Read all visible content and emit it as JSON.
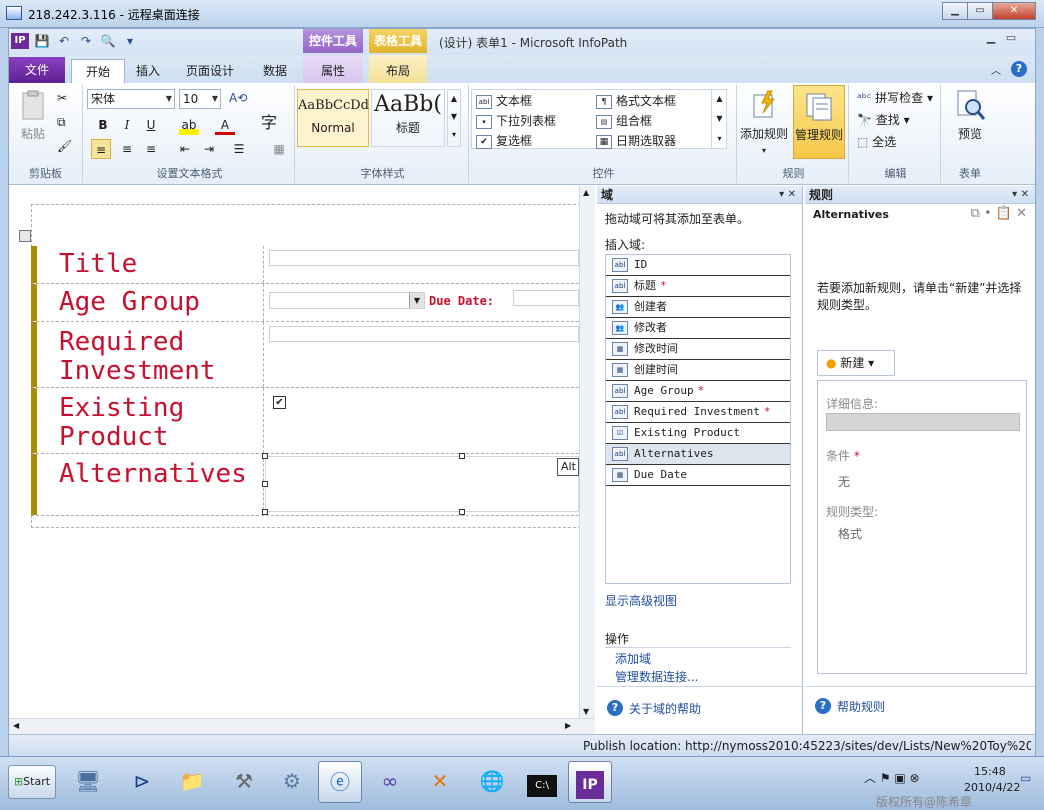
{
  "rdp": {
    "title": "218.242.3.116 - 远程桌面连接",
    "min": "▁",
    "max": "▭",
    "close": "✕"
  },
  "qat": {
    "logo": "IP",
    "save": "💾",
    "undo": "↶",
    "redo": "↷",
    "preview": "🔍",
    "more": "▾"
  },
  "context_tabs": {
    "controls": "控件工具",
    "table": "表格工具"
  },
  "app_title": "(设计) 表单1 - Microsoft InfoPath",
  "tabs": {
    "file": "文件",
    "home": "开始",
    "insert": "插入",
    "page_design": "页面设计",
    "data": "数据",
    "properties": "属性",
    "layout": "布局"
  },
  "ribbon": {
    "clipboard": {
      "paste": "粘贴",
      "label": "剪贴板"
    },
    "font": {
      "name": "宋体",
      "size": "10",
      "label": "设置文本格式",
      "bold": "B",
      "italic": "I",
      "underline": "U",
      "char": "字"
    },
    "styles": {
      "normal_preview": "AaBbCcDd",
      "normal": "Normal",
      "heading_preview": "AaBb(",
      "heading": "标题",
      "label": "字体样式"
    },
    "controls": {
      "items": [
        "文本框",
        "格式文本框",
        "下拉列表框",
        "组合框",
        "复选框",
        "日期选取器"
      ],
      "label": "控件"
    },
    "rules": {
      "add_rule": "添加规则",
      "manage_rules": "管理规则",
      "label": "规则"
    },
    "editing": {
      "spell": "拼写检查",
      "find": "查找",
      "select_all": "全选",
      "label": "编辑"
    },
    "form": {
      "preview": "预览",
      "label": "表单"
    }
  },
  "form": {
    "rows": [
      {
        "label": "Title"
      },
      {
        "label": "Age Group",
        "due_label": "Due Date:"
      },
      {
        "label": "Required Investment"
      },
      {
        "label": "Existing Product",
        "checkbox": "✔"
      },
      {
        "label": "Alternatives",
        "tag": "Alt"
      }
    ]
  },
  "fields_pane": {
    "title": "域",
    "hint": "拖动域可将其添加至表单。",
    "insert_label": "插入域:",
    "fields": [
      {
        "name": "ID",
        "icon": "abl",
        "required": false
      },
      {
        "name": "标题",
        "icon": "abl",
        "required": true
      },
      {
        "name": "创建者",
        "icon": "👥",
        "required": false
      },
      {
        "name": "修改者",
        "icon": "👥",
        "required": false
      },
      {
        "name": "修改时间",
        "icon": "▦",
        "required": false
      },
      {
        "name": "创建时间",
        "icon": "▦",
        "required": false
      },
      {
        "name": "Age Group",
        "icon": "abl",
        "required": true
      },
      {
        "name": "Required Investment",
        "icon": "abl",
        "required": true
      },
      {
        "name": "Existing Product",
        "icon": "☑",
        "required": false
      },
      {
        "name": "Alternatives",
        "icon": "abl",
        "required": false
      },
      {
        "name": "Due Date",
        "icon": "▦",
        "required": false
      }
    ],
    "required_mark": "*",
    "advanced_view": "显示高级视图",
    "actions_label": "操作",
    "add_field": "添加域",
    "manage_connections": "管理数据连接...",
    "help": "关于域的帮助"
  },
  "rules_pane": {
    "title": "规则",
    "subject": "Alternatives",
    "hint": "若要添加新规则，请单击“新建”并选择规则类型。",
    "new_button": "新建",
    "details_label": "详细信息:",
    "condition_label": "条件",
    "condition_value": "无",
    "type_label": "规则类型:",
    "type_value": "格式",
    "help": "帮助规则"
  },
  "status": {
    "publish": "Publish location: http://nymoss2010:45223/sites/dev/Lists/New%20Toy%20..."
  },
  "taskbar": {
    "start": "Start",
    "time": "15:48",
    "date": "2010/4/22",
    "watermark": "版权所有@陈希章"
  }
}
